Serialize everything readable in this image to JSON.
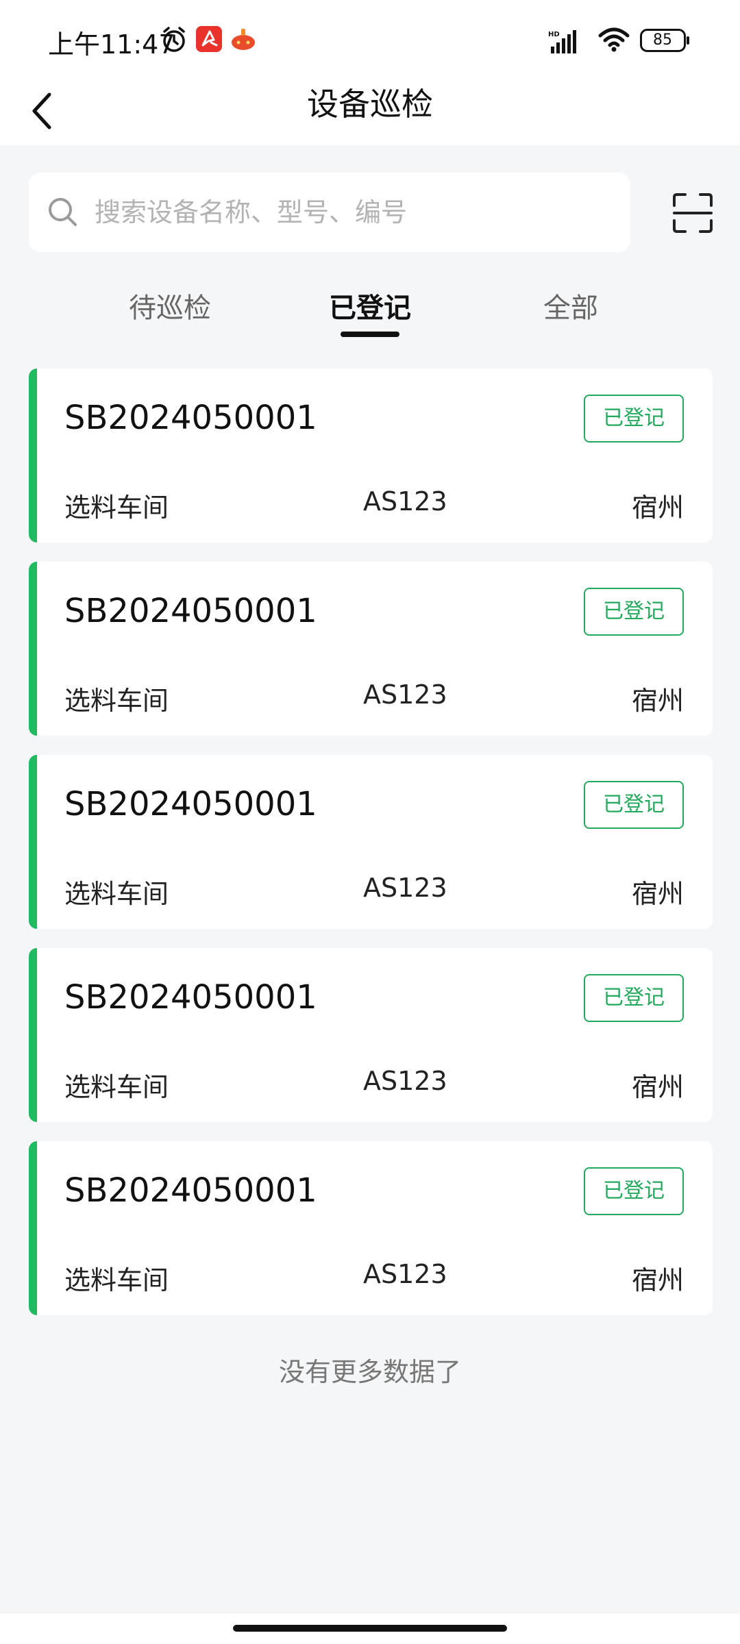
{
  "status_bar": {
    "time": "上午11:47",
    "network_label": "HD",
    "battery": "85"
  },
  "header": {
    "title": "设备巡检"
  },
  "search": {
    "placeholder": "搜索设备名称、型号、编号"
  },
  "tabs": [
    {
      "label": "待巡检",
      "active": false
    },
    {
      "label": "已登记",
      "active": true
    },
    {
      "label": "全部",
      "active": false
    }
  ],
  "colors": {
    "accent": "#1ebc62",
    "badge": "#22a95c",
    "background": "#f5f6f7"
  },
  "records": [
    {
      "code": "SB2024050001",
      "status": "已登记",
      "workshop": "选料车间",
      "model": "AS123",
      "city": "宿州"
    },
    {
      "code": "SB2024050001",
      "status": "已登记",
      "workshop": "选料车间",
      "model": "AS123",
      "city": "宿州"
    },
    {
      "code": "SB2024050001",
      "status": "已登记",
      "workshop": "选料车间",
      "model": "AS123",
      "city": "宿州"
    },
    {
      "code": "SB2024050001",
      "status": "已登记",
      "workshop": "选料车间",
      "model": "AS123",
      "city": "宿州"
    },
    {
      "code": "SB2024050001",
      "status": "已登记",
      "workshop": "选料车间",
      "model": "AS123",
      "city": "宿州"
    }
  ],
  "footer": {
    "no_more": "没有更多数据了"
  }
}
